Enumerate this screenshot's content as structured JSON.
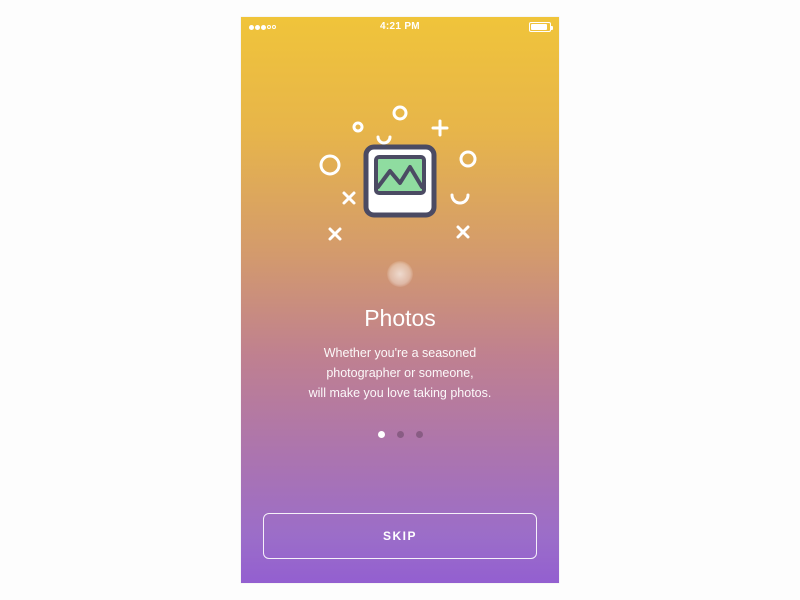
{
  "status_bar": {
    "time": "4:21 PM"
  },
  "onboarding": {
    "title": "Photos",
    "body_line1": "Whether you're a seasoned",
    "body_line2": "photographer or someone,",
    "body_line3": "will make you love taking photos."
  },
  "pagination": {
    "count": 3,
    "active_index": 0
  },
  "skip_button": {
    "label": "SKIP"
  }
}
